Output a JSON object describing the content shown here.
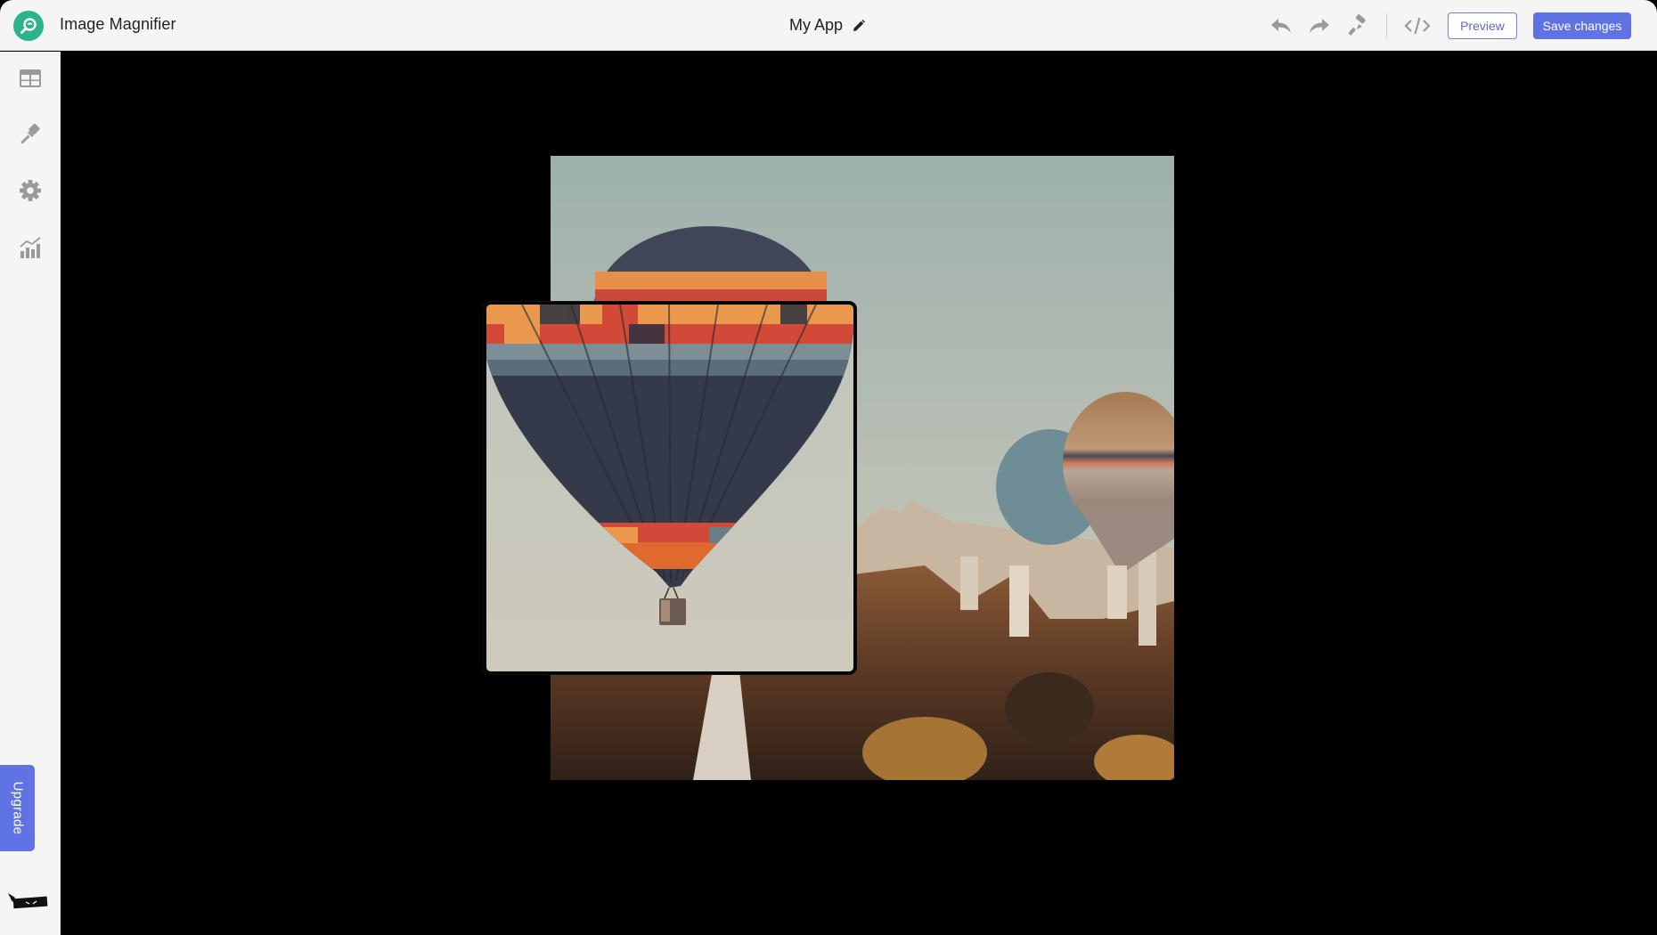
{
  "header": {
    "app_name": "Image Magnifier",
    "logo_icon": "magnifier-icon",
    "document_title": "My App",
    "edit_title_icon": "pencil-icon",
    "toolbar": {
      "undo_icon": "undo-icon",
      "redo_icon": "redo-icon",
      "theme_icon": "paint-roller-icon",
      "code_icon": "code-icon",
      "preview_label": "Preview",
      "save_label": "Save changes"
    }
  },
  "sidebar": {
    "items": [
      {
        "name": "data",
        "icon": "table-icon"
      },
      {
        "name": "design",
        "icon": "paintbrush-icon"
      },
      {
        "name": "settings",
        "icon": "gear-icon"
      },
      {
        "name": "analytics",
        "icon": "chart-icon"
      }
    ],
    "upgrade_label": "Upgrade",
    "mascot_icon": "ninja-mascot-icon"
  },
  "canvas": {
    "image_description": "Hot air balloons over Cappadocia rock formations",
    "magnifier_lens": "zoomed view of striped hot air balloon with basket"
  },
  "colors": {
    "brand_green": "#2db38a",
    "accent_blue": "#5f73e4",
    "header_bg": "#f5f5f5",
    "icon_gray": "#9a9a9a",
    "canvas_bg": "#000000"
  }
}
